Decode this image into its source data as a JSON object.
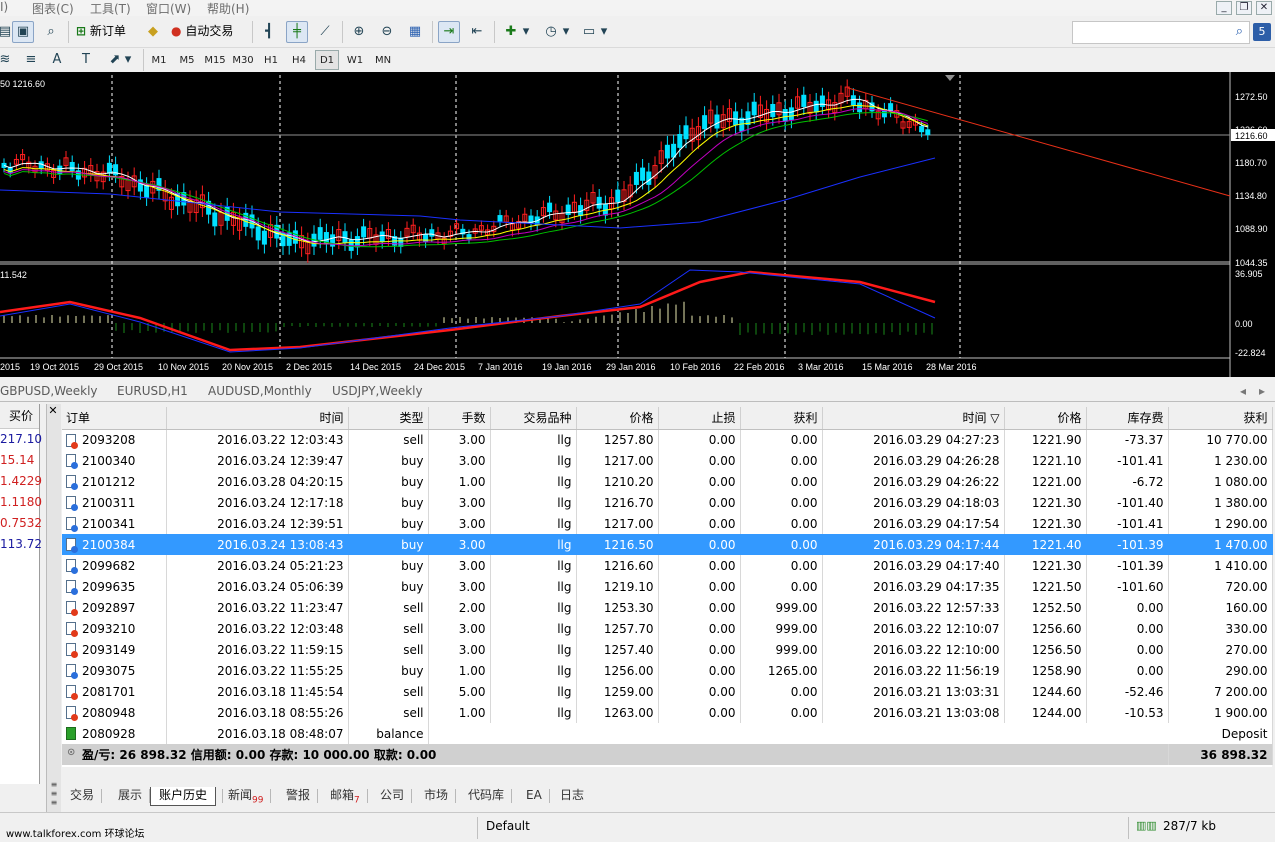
{
  "menu": {
    "items": [
      "I)",
      "图表(C)",
      "工具(T)",
      "窗口(W)",
      "帮助(H)"
    ]
  },
  "toolbar": {
    "new_order": "新订单",
    "auto_trade": "自动交易",
    "font_a": "A",
    "text_t": "T"
  },
  "timeframes": [
    "M1",
    "M5",
    "M15",
    "M30",
    "H1",
    "H4",
    "D1",
    "W1",
    "MN"
  ],
  "timeframe_selected": "D1",
  "chart": {
    "title_info": "50 1216.60",
    "price_levels": [
      "1272.50",
      "1226.60",
      "1216.60",
      "1180.70",
      "1134.80",
      "1088.90",
      "1044.35"
    ],
    "current_price": "1216.60",
    "macd_levels": [
      "36.905",
      "0.00",
      "-22.824"
    ],
    "macd_title": "11.542",
    "date_labels": [
      "2015",
      "19 Oct 2015",
      "29 Oct 2015",
      "10 Nov 2015",
      "20 Nov 2015",
      "2 Dec 2015",
      "14 Dec 2015",
      "24 Dec 2015",
      "7 Jan 2016",
      "19 Jan 2016",
      "29 Jan 2016",
      "10 Feb 2016",
      "22 Feb 2016",
      "3 Mar 2016",
      "15 Mar 2016",
      "28 Mar 2016"
    ],
    "colors": {
      "bull": "#00e0ff",
      "bear": "#ff2020",
      "ma_fast": "#ffffff",
      "ma_mid": "#ffff00",
      "ma_green": "#00c000",
      "ma_purple": "#c000c0",
      "ma_blue": "#1a30ff",
      "trend": "#e83018",
      "macd_signal": "#ff1a1a",
      "macd_line": "#1a30ff",
      "hist_pos": "#e8e8b0",
      "hist_neg": "#1a8a1a"
    }
  },
  "chart_tabs": [
    "GBPUSD,Weekly",
    "EURUSD,H1",
    "AUDUSD,Monthly",
    "USDJPY,Weekly"
  ],
  "left_panel": {
    "header": "买价",
    "values": [
      "217.10",
      "15.14",
      "1.4229",
      "1.1180",
      "0.7532",
      "113.72"
    ],
    "colors": [
      "#1a1aa0",
      "#d02020",
      "#d02020",
      "#d02020",
      "#d02020",
      "#1a1aa0"
    ]
  },
  "table": {
    "headers": [
      "订单",
      "时间",
      "类型",
      "手数",
      "交易品种",
      "价格",
      "止损",
      "获利",
      "时间 ▽",
      "价格",
      "库存费",
      "获利"
    ],
    "rows": [
      {
        "icon": "red",
        "cells": [
          "2093208",
          "2016.03.22 12:03:43",
          "sell",
          "3.00",
          "llg",
          "1257.80",
          "0.00",
          "0.00",
          "2016.03.29 04:27:23",
          "1221.90",
          "-73.37",
          "10 770.00"
        ]
      },
      {
        "icon": "blue",
        "cells": [
          "2100340",
          "2016.03.24 12:39:47",
          "buy",
          "3.00",
          "llg",
          "1217.00",
          "0.00",
          "0.00",
          "2016.03.29 04:26:28",
          "1221.10",
          "-101.41",
          "1 230.00"
        ]
      },
      {
        "icon": "blue",
        "cells": [
          "2101212",
          "2016.03.28 04:20:15",
          "buy",
          "1.00",
          "llg",
          "1210.20",
          "0.00",
          "0.00",
          "2016.03.29 04:26:22",
          "1221.00",
          "-6.72",
          "1 080.00"
        ]
      },
      {
        "icon": "blue",
        "cells": [
          "2100311",
          "2016.03.24 12:17:18",
          "buy",
          "3.00",
          "llg",
          "1216.70",
          "0.00",
          "0.00",
          "2016.03.29 04:18:03",
          "1221.30",
          "-101.40",
          "1 380.00"
        ]
      },
      {
        "icon": "blue",
        "cells": [
          "2100341",
          "2016.03.24 12:39:51",
          "buy",
          "3.00",
          "llg",
          "1217.00",
          "0.00",
          "0.00",
          "2016.03.29 04:17:54",
          "1221.30",
          "-101.41",
          "1 290.00"
        ]
      },
      {
        "icon": "blue",
        "selected": true,
        "cells": [
          "2100384",
          "2016.03.24 13:08:43",
          "buy",
          "3.00",
          "llg",
          "1216.50",
          "0.00",
          "0.00",
          "2016.03.29 04:17:44",
          "1221.40",
          "-101.39",
          "1 470.00"
        ]
      },
      {
        "icon": "blue",
        "cells": [
          "2099682",
          "2016.03.24 05:21:23",
          "buy",
          "3.00",
          "llg",
          "1216.60",
          "0.00",
          "0.00",
          "2016.03.29 04:17:40",
          "1221.30",
          "-101.39",
          "1 410.00"
        ]
      },
      {
        "icon": "blue",
        "cells": [
          "2099635",
          "2016.03.24 05:06:39",
          "buy",
          "3.00",
          "llg",
          "1219.10",
          "0.00",
          "0.00",
          "2016.03.29 04:17:35",
          "1221.50",
          "-101.60",
          "720.00"
        ]
      },
      {
        "icon": "red",
        "cells": [
          "2092897",
          "2016.03.22 11:23:47",
          "sell",
          "2.00",
          "llg",
          "1253.30",
          "0.00",
          "999.00",
          "2016.03.22 12:57:33",
          "1252.50",
          "0.00",
          "160.00"
        ]
      },
      {
        "icon": "red",
        "cells": [
          "2093210",
          "2016.03.22 12:03:48",
          "sell",
          "3.00",
          "llg",
          "1257.70",
          "0.00",
          "999.00",
          "2016.03.22 12:10:07",
          "1256.60",
          "0.00",
          "330.00"
        ]
      },
      {
        "icon": "red",
        "cells": [
          "2093149",
          "2016.03.22 11:59:15",
          "sell",
          "3.00",
          "llg",
          "1257.40",
          "0.00",
          "999.00",
          "2016.03.22 12:10:00",
          "1256.50",
          "0.00",
          "270.00"
        ]
      },
      {
        "icon": "blue",
        "cells": [
          "2093075",
          "2016.03.22 11:55:25",
          "buy",
          "1.00",
          "llg",
          "1256.00",
          "0.00",
          "1265.00",
          "2016.03.22 11:56:19",
          "1258.90",
          "0.00",
          "290.00"
        ]
      },
      {
        "icon": "red",
        "cells": [
          "2081701",
          "2016.03.18 11:45:54",
          "sell",
          "5.00",
          "llg",
          "1259.00",
          "0.00",
          "0.00",
          "2016.03.21 13:03:31",
          "1244.60",
          "-52.46",
          "7 200.00"
        ]
      },
      {
        "icon": "red",
        "cells": [
          "2080948",
          "2016.03.18 08:55:26",
          "sell",
          "1.00",
          "llg",
          "1263.00",
          "0.00",
          "0.00",
          "2016.03.21 13:03:08",
          "1244.00",
          "-10.53",
          "1 900.00"
        ]
      }
    ],
    "balance_row": {
      "order": "2080928",
      "time": "2016.03.18 08:48:07",
      "type": "balance",
      "comment": "Deposit",
      "amount": "10 000.00"
    },
    "summary": {
      "text": "盈/亏: 26 898.32  信用额: 0.00  存款: 10 000.00  取款: 0.00",
      "total": "36 898.32"
    }
  },
  "bottom_tabs": [
    {
      "label": "交易",
      "badge": ""
    },
    {
      "label": "展示",
      "badge": ""
    },
    {
      "label": "账户历史",
      "badge": "",
      "active": true
    },
    {
      "label": "新闻",
      "badge": "99"
    },
    {
      "label": "警报",
      "badge": ""
    },
    {
      "label": "邮箱",
      "badge": "7"
    },
    {
      "label": "公司",
      "badge": ""
    },
    {
      "label": "市场",
      "badge": ""
    },
    {
      "label": "代码库",
      "badge": ""
    },
    {
      "label": "EA",
      "badge": ""
    },
    {
      "label": "日志",
      "badge": ""
    }
  ],
  "status": {
    "watermark": "www.talkforex.com 环球论坛",
    "profile": "Default",
    "traffic": "287/7 kb"
  }
}
